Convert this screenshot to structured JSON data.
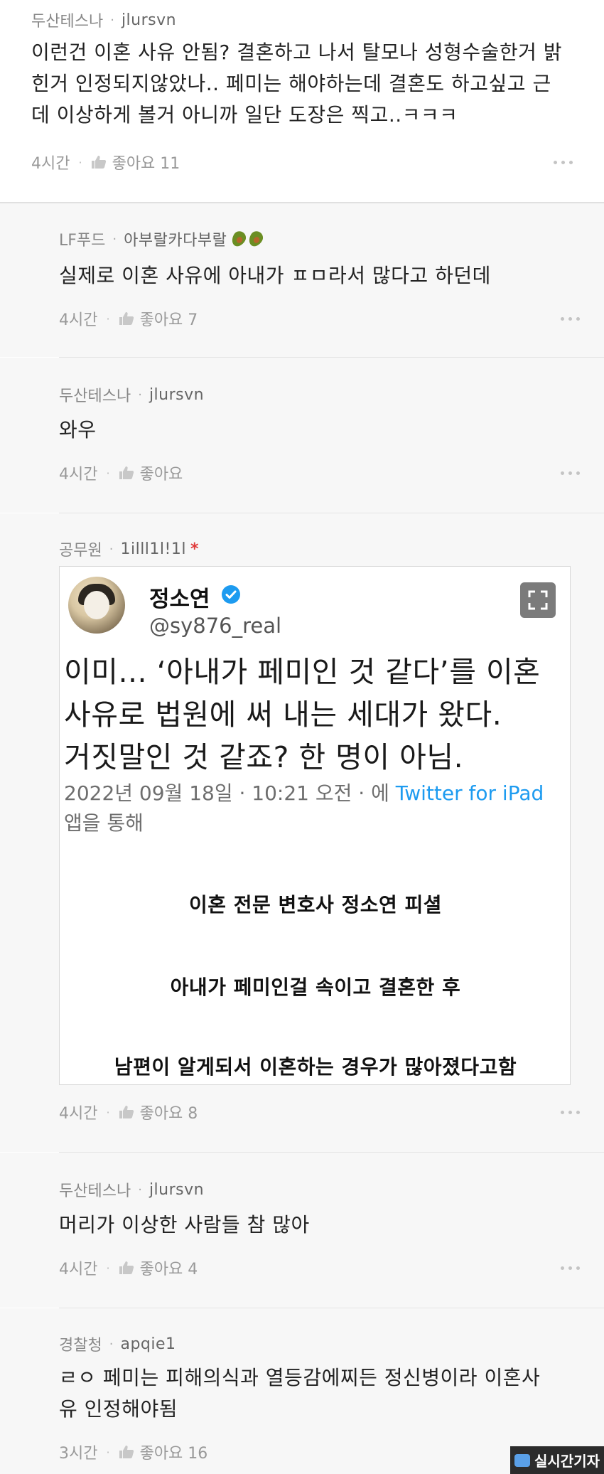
{
  "comments": [
    {
      "company": "두산테스나",
      "user": "jlursvn",
      "text_lines": [
        "이런건 이혼 사유 안됨? 결혼하고 나서 탈모나 성형수술한거 밝",
        "힌거 인정되지않았나.. 페미는 해야하는데 결혼도 하고싶고 근",
        "데 이상하게 볼거 아니까 일단 도장은 찍고..ㅋㅋㅋ"
      ],
      "time": "4시간",
      "like_label": "좋아요 11"
    },
    {
      "company": "LF푸드",
      "user": "아부랄카다부랄",
      "text_lines": [
        "실제로 이혼 사유에 아내가 ㅍㅁ라서 많다고 하던데"
      ],
      "time": "4시간",
      "like_label": "좋아요 7"
    },
    {
      "company": "두산테스나",
      "user": "jlursvn",
      "text_lines": [
        "와우"
      ],
      "time": "4시간",
      "like_label": "좋아요"
    },
    {
      "company": "공무원",
      "user": "1illl1l!1l",
      "badge": "*",
      "time": "4시간",
      "like_label": "좋아요 8"
    },
    {
      "company": "두산테스나",
      "user": "jlursvn",
      "text_lines": [
        "머리가 이상한 사람들 참 많아"
      ],
      "time": "4시간",
      "like_label": "좋아요 4"
    },
    {
      "company": "경찰청",
      "user": "apqie1",
      "text_lines": [
        "ㄹㅇ 페미는 피해의식과 열등감에찌든 정신병이라 이혼사",
        "유 인정해야됨"
      ],
      "time": "3시간",
      "like_label": "좋아요 16"
    }
  ],
  "embedded_image": {
    "tweet_name": "정소연",
    "tweet_handle": "@sy876_real",
    "tweet_lines": [
      "이미... ‘아내가 페미인 것 같다’를 이혼",
      "사유로 법원에 써 내는 세대가 왔다.",
      "거짓말인 것 같죠? 한 명이 아님."
    ],
    "tweet_date": "2022년 09월 18일 · 10:21 오전 · 에",
    "tweet_source": "Twitter for iPad",
    "tweet_date_line2": "앱을 통해",
    "caption_lines": [
      "이혼 전문 변호사 정소연 피셜",
      "아내가 페미인걸 속이고 결혼한 후",
      "남편이 알게되서 이혼하는 경우가 많아졌다고함"
    ]
  },
  "watermark": {
    "text": "실시간기자"
  },
  "icons": {
    "like": "thumbs-up-icon",
    "more": "more-dots-icon",
    "verified": "verified-badge-icon",
    "expand": "expand-icon"
  }
}
